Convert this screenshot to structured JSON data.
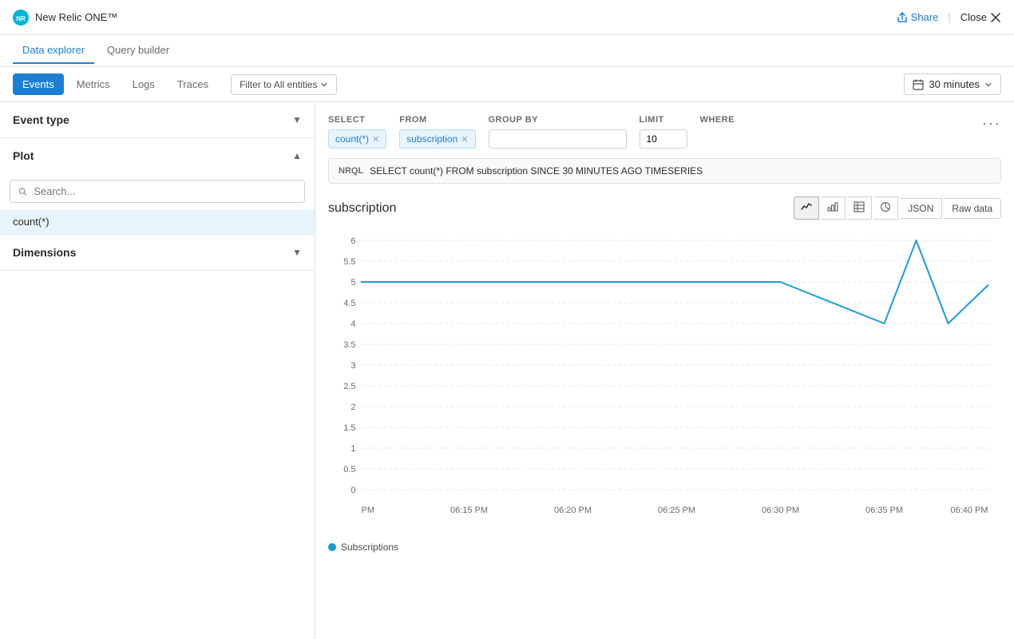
{
  "app": {
    "logo_text": "NR",
    "title": "New Relic ONE™"
  },
  "topbar": {
    "share_label": "Share",
    "close_label": "Close"
  },
  "nav": {
    "tabs": [
      {
        "label": "Data explorer",
        "active": true
      },
      {
        "label": "Query builder",
        "active": false
      }
    ]
  },
  "secondary_nav": {
    "tabs": [
      {
        "label": "Events",
        "active": true
      },
      {
        "label": "Metrics",
        "active": false
      },
      {
        "label": "Logs",
        "active": false
      },
      {
        "label": "Traces",
        "active": false
      }
    ],
    "filter_label": "Filter to All entities",
    "time_label": "30 minutes"
  },
  "sidebar": {
    "event_type": {
      "title": "Event type"
    },
    "plot": {
      "title": "Plot",
      "search_placeholder": "Search...",
      "active_item": "count(*)"
    },
    "dimensions": {
      "title": "Dimensions"
    }
  },
  "query": {
    "select_label": "SELECT",
    "from_label": "FROM",
    "group_by_label": "GROUP BY",
    "limit_label": "LIMIT",
    "where_label": "WHERE",
    "select_value": "count(*)",
    "from_value": "subscription",
    "limit_value": "10",
    "group_by_placeholder": "",
    "more_icon": "•••"
  },
  "nrql": {
    "label": "NRQL",
    "query": "SELECT count(*) FROM subscription SINCE 30 MINUTES AGO TIMESERIES"
  },
  "chart": {
    "title": "subscription",
    "toolbar": [
      {
        "icon": "line-chart",
        "active": true
      },
      {
        "icon": "bar-chart",
        "active": false
      },
      {
        "icon": "table",
        "active": false
      },
      {
        "icon": "pie-chart",
        "active": false
      }
    ],
    "json_label": "JSON",
    "raw_data_label": "Raw data",
    "y_axis": [
      "6",
      "5.5",
      "5",
      "4.5",
      "4",
      "3.5",
      "3",
      "2.5",
      "2",
      "1.5",
      "1",
      "0.5",
      "0"
    ],
    "x_axis": [
      "PM",
      "06:15 PM",
      "06:20 PM",
      "06:25 PM",
      "06:30 PM",
      "06:35 PM",
      "06:40 PM"
    ],
    "legend_label": "Subscriptions"
  }
}
